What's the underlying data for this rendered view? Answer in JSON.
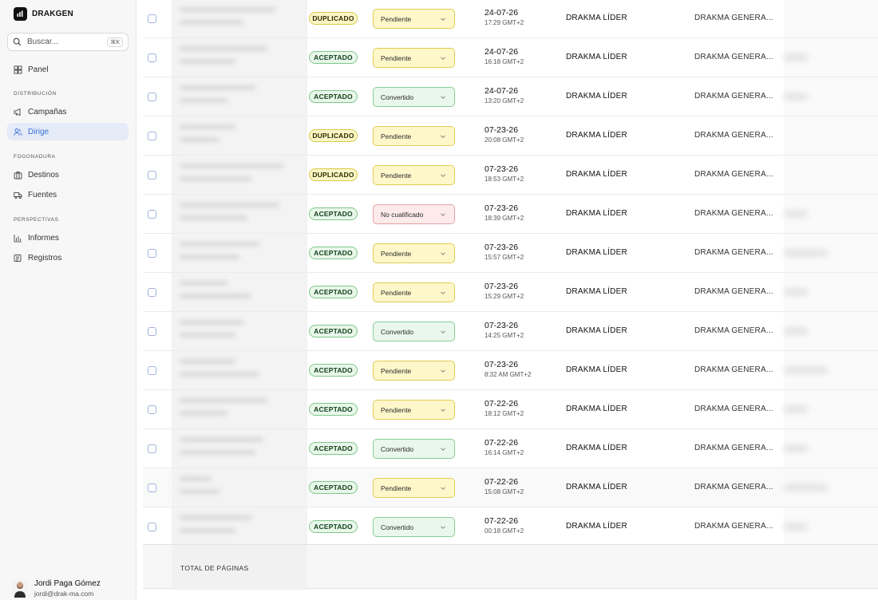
{
  "brand": {
    "name": "DRAKGEN"
  },
  "search": {
    "placeholder": "Buscar...",
    "shortcut": "⌘K"
  },
  "nav": {
    "panel": "Panel",
    "sections": [
      {
        "label": "DISTRIBUCIÓN",
        "items": [
          "Campañas",
          "Dirige"
        ]
      },
      {
        "label": "FOGONADURA",
        "items": [
          "Destinos",
          "Fuentes"
        ]
      },
      {
        "label": "PERSPECTIVAS",
        "items": [
          "Informes",
          "Registros"
        ]
      }
    ],
    "active": "Dirige"
  },
  "user": {
    "name": "Jordi Paga Gómez",
    "email": "jordi@drak-ma.com"
  },
  "rows": [
    {
      "tag": "DUPLICADO",
      "status": "Pendiente",
      "date": "24-07-26",
      "time": "17:29 GMT+2",
      "owner": "DRAKMA LÍDER",
      "company": "DRAKMA GENERA..."
    },
    {
      "tag": "ACEPTADO",
      "status": "Pendiente",
      "date": "24-07-26",
      "time": "16:18 GMT+2",
      "owner": "DRAKMA LÍDER",
      "company": "DRAKMA GENERA..."
    },
    {
      "tag": "ACEPTADO",
      "status": "Convertido",
      "date": "24-07-26",
      "time": "13:20 GMT+2",
      "owner": "DRAKMA LÍDER",
      "company": "DRAKMA GENERA..."
    },
    {
      "tag": "DUPLICADO",
      "status": "Pendiente",
      "date": "07-23-26",
      "time": "20:08 GMT+2",
      "owner": "DRAKMA LÍDER",
      "company": "DRAKMA GENERA..."
    },
    {
      "tag": "DUPLICADO",
      "status": "Pendiente",
      "date": "07-23-26",
      "time": "18:53 GMT+2",
      "owner": "DRAKMA LÍDER",
      "company": "DRAKMA GENERA..."
    },
    {
      "tag": "ACEPTADO",
      "status": "No cualificado",
      "date": "07-23-26",
      "time": "18:39 GMT+2",
      "owner": "DRAKMA LÍDER",
      "company": "DRAKMA GENERA..."
    },
    {
      "tag": "ACEPTADO",
      "status": "Pendiente",
      "date": "07-23-26",
      "time": "15:57 GMT+2",
      "owner": "DRAKMA LÍDER",
      "company": "DRAKMA GENERA..."
    },
    {
      "tag": "ACEPTADO",
      "status": "Pendiente",
      "date": "07-23-26",
      "time": "15:29 GMT+2",
      "owner": "DRAKMA LÍDER",
      "company": "DRAKMA GENERA..."
    },
    {
      "tag": "ACEPTADO",
      "status": "Convertido",
      "date": "07-23-26",
      "time": "14:25 GMT+2",
      "owner": "DRAKMA LÍDER",
      "company": "DRAKMA GENERA..."
    },
    {
      "tag": "ACEPTADO",
      "status": "Pendiente",
      "date": "07-23-26",
      "time": "8:32 AM GMT+2",
      "owner": "DRAKMA LÍDER",
      "company": "DRAKMA GENERA..."
    },
    {
      "tag": "ACEPTADO",
      "status": "Pendiente",
      "date": "07-22-26",
      "time": "18:12 GMT+2",
      "owner": "DRAKMA LÍDER",
      "company": "DRAKMA GENERA..."
    },
    {
      "tag": "ACEPTADO",
      "status": "Convertido",
      "date": "07-22-26",
      "time": "16:14 GMT+2",
      "owner": "DRAKMA LÍDER",
      "company": "DRAKMA GENERA..."
    },
    {
      "tag": "ACEPTADO",
      "status": "Pendiente",
      "date": "07-22-26",
      "time": "15:08 GMT+2",
      "owner": "DRAKMA LÍDER",
      "company": "DRAKMA GENERA..."
    },
    {
      "tag": "ACEPTADO",
      "status": "Convertido",
      "date": "07-22-26",
      "time": "00:18 GMT+2",
      "owner": "DRAKMA LÍDER",
      "company": "DRAKMA GENERA..."
    }
  ],
  "footer": {
    "label": "TOTAL DE PÁGINAS"
  },
  "colors": {
    "accent": "#3a6fd8",
    "pending": "#fdf7c9",
    "converted": "#e9f7ec",
    "unqualified": "#fdeaea"
  }
}
